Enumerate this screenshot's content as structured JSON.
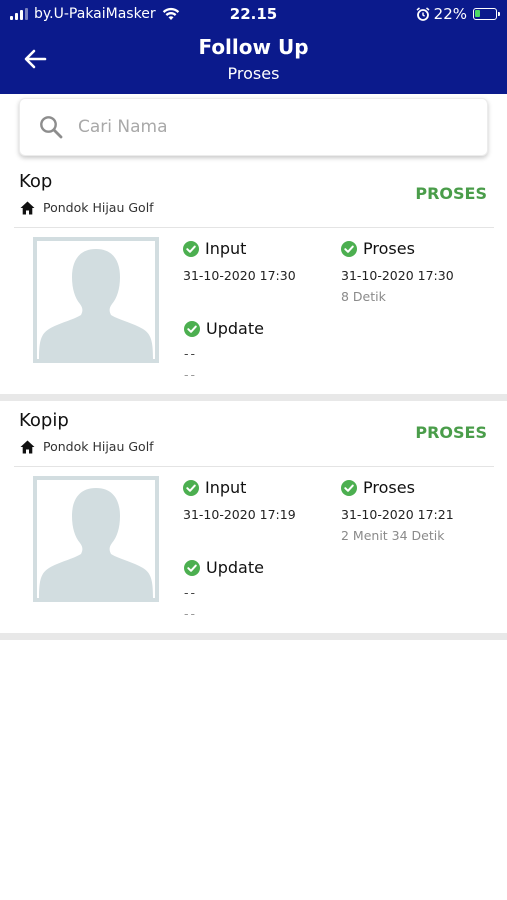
{
  "status_bar": {
    "carrier": "by.U-PakaiMasker",
    "time": "22.15",
    "battery": "22%"
  },
  "header": {
    "title": "Follow Up",
    "subtitle": "Proses"
  },
  "search": {
    "placeholder": "Cari Nama",
    "value": ""
  },
  "cards": [
    {
      "name": "Kop",
      "location": "Pondok Hijau Golf",
      "status": "PROSES",
      "input": {
        "label": "Input",
        "time": "31-10-2020 17:30"
      },
      "proses": {
        "label": "Proses",
        "time": "31-10-2020 17:30",
        "duration": "8 Detik"
      },
      "update": {
        "label": "Update",
        "line1": "--",
        "line2": "--"
      }
    },
    {
      "name": "Kopip",
      "location": "Pondok Hijau Golf",
      "status": "PROSES",
      "input": {
        "label": "Input",
        "time": "31-10-2020 17:19"
      },
      "proses": {
        "label": "Proses",
        "time": "31-10-2020 17:21",
        "duration": "2 Menit 34 Detik"
      },
      "update": {
        "label": "Update",
        "line1": "--",
        "line2": "--"
      }
    }
  ],
  "colors": {
    "header_bg": "#0b1a8c",
    "status_green": "#4a9d4a",
    "check_green": "#4caf50"
  }
}
